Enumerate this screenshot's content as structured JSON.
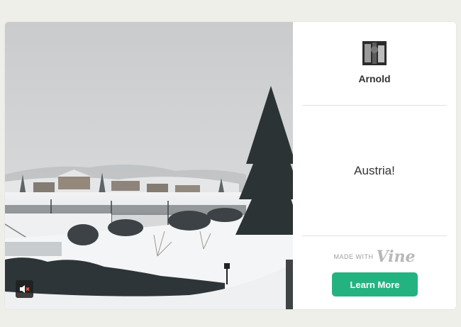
{
  "post": {
    "username": "Arnold",
    "caption": "Austria!"
  },
  "branding": {
    "made_with_label": "MADE WITH",
    "logo_text": "Vine"
  },
  "cta": {
    "label": "Learn More"
  },
  "video": {
    "muted": true
  },
  "colors": {
    "accent_green": "#25b281",
    "page_background": "#efefea"
  }
}
